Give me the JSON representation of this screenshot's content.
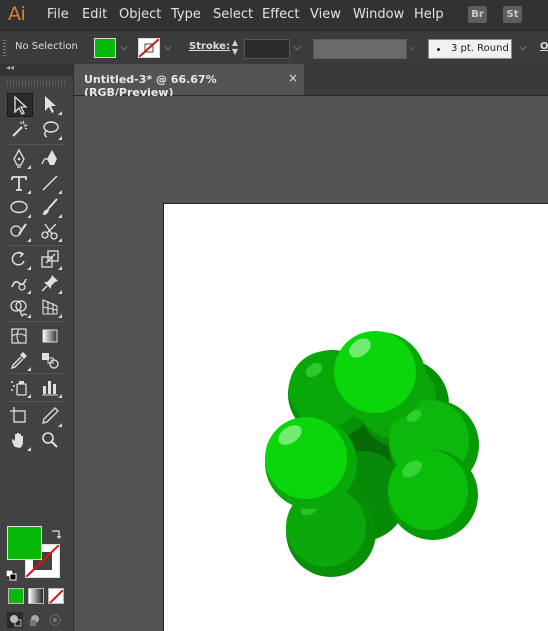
{
  "app": {
    "logo": "Ai"
  },
  "menu": [
    "File",
    "Edit",
    "Object",
    "Type",
    "Select",
    "Effect",
    "View",
    "Window",
    "Help"
  ],
  "bridge": {
    "br": "Br",
    "st": "St"
  },
  "control": {
    "selection_label": "No Selection",
    "stroke_label": "Stroke:",
    "brush_label": "3 pt. Round",
    "opacity_label": "O",
    "fill_color": "#09b909"
  },
  "document": {
    "tab_title": "Untitled-3* @ 66.67% (RGB/Preview)",
    "close_glyph": "×"
  },
  "colors": {
    "fill": "#09b909",
    "sphere_light": "#0bd60b",
    "sphere_mid": "#09b009",
    "sphere_dark": "#078a07",
    "core": "#066a06"
  },
  "tools": [
    "selection-tool",
    "direct-selection-tool",
    "magic-wand-tool",
    "lasso-tool",
    "pen-tool",
    "curvature-tool",
    "type-tool",
    "line-segment-tool",
    "ellipse-tool",
    "paintbrush-tool",
    "shaper-tool",
    "scissors-tool",
    "rotate-tool",
    "scale-tool",
    "warp-tool",
    "puppet-warp-tool",
    "shape-builder-tool",
    "perspective-grid-tool",
    "mesh-tool",
    "gradient-tool",
    "eyedropper-tool",
    "blend-tool",
    "symbol-sprayer-tool",
    "column-graph-tool",
    "artboard-tool",
    "slice-tool",
    "hand-tool",
    "zoom-tool"
  ]
}
